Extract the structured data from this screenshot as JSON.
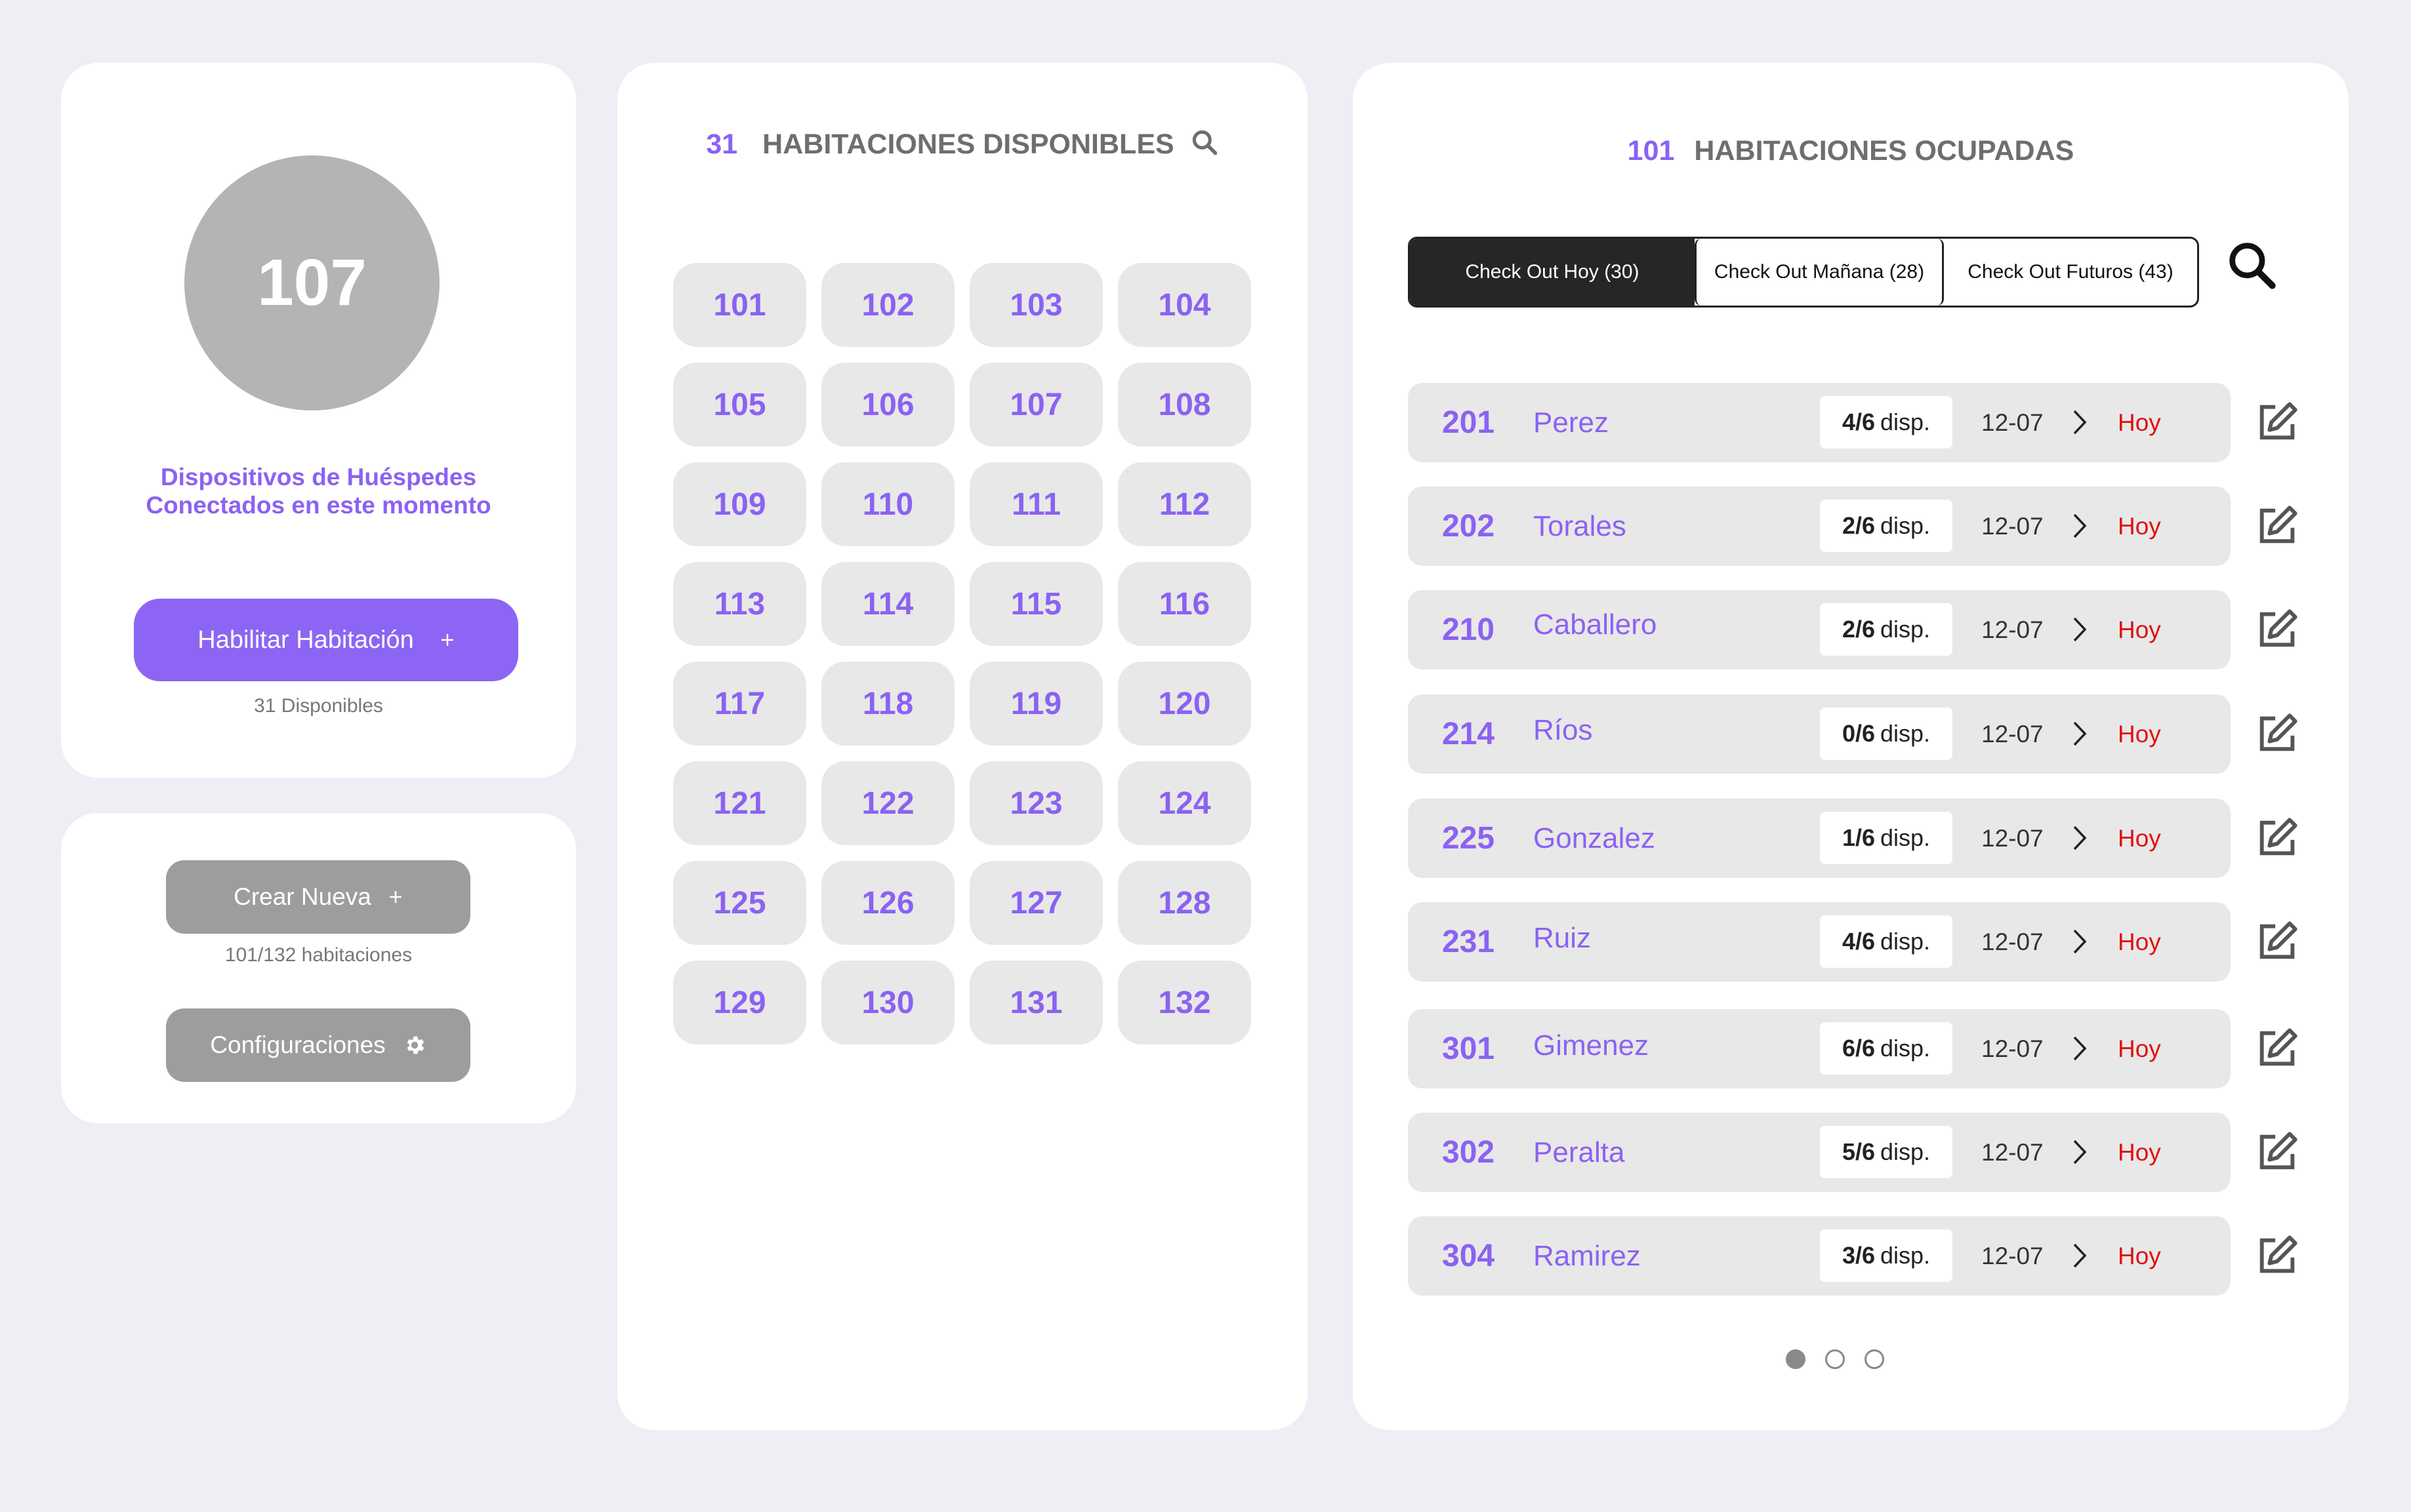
{
  "colors": {
    "accent": "#8b62f2",
    "danger": "#e01010",
    "background": "#eeeff4"
  },
  "devices": {
    "count": "107",
    "label_line1": "Dispositivos de Huéspedes",
    "label_line2": "Conectados en este momento",
    "enable_button": "Habilitar Habitación",
    "enable_button_icon": "plus-icon",
    "available_note": "31 Disponibles"
  },
  "actions": {
    "create_button": "Crear Nueva",
    "create_note": "101/132 habitaciones",
    "settings_button": "Configuraciones",
    "settings_icon": "gear-icon"
  },
  "available": {
    "count": "31",
    "title": "HABITACIONES DISPONIBLES",
    "rooms": [
      "101",
      "102",
      "103",
      "104",
      "105",
      "106",
      "107",
      "108",
      "109",
      "110",
      "111",
      "112",
      "113",
      "114",
      "115",
      "116",
      "117",
      "118",
      "119",
      "120",
      "121",
      "122",
      "123",
      "124",
      "125",
      "126",
      "127",
      "128",
      "129",
      "130",
      "131",
      "132"
    ]
  },
  "occupied": {
    "count": "101",
    "title": "HABITACIONES OCUPADAS",
    "tabs": [
      {
        "label": "Check Out Hoy (30)",
        "active": true
      },
      {
        "label": "Check Out Mañana (28)",
        "active": false
      },
      {
        "label": "Check Out Futuros (43)",
        "active": false
      }
    ],
    "rows": [
      {
        "room": "201",
        "name": "Perez",
        "devices": "4/6",
        "unit": "disp.",
        "date": "12-07",
        "status": "Hoy"
      },
      {
        "room": "202",
        "name": "Torales",
        "devices": "2/6",
        "unit": "disp.",
        "date": "12-07",
        "status": "Hoy"
      },
      {
        "room": "210",
        "name": "Caballero",
        "devices": "2/6",
        "unit": "disp.",
        "date": "12-07",
        "status": "Hoy"
      },
      {
        "room": "214",
        "name": "Ríos",
        "devices": "0/6",
        "unit": "disp.",
        "date": "12-07",
        "status": "Hoy"
      },
      {
        "room": "225",
        "name": "Gonzalez",
        "devices": "1/6",
        "unit": "disp.",
        "date": "12-07",
        "status": "Hoy"
      },
      {
        "room": "231",
        "name": "Ruiz",
        "devices": "4/6",
        "unit": "disp.",
        "date": "12-07",
        "status": "Hoy"
      },
      {
        "room": "301",
        "name": "Gimenez",
        "devices": "6/6",
        "unit": "disp.",
        "date": "12-07",
        "status": "Hoy"
      },
      {
        "room": "302",
        "name": "Peralta",
        "devices": "5/6",
        "unit": "disp.",
        "date": "12-07",
        "status": "Hoy"
      },
      {
        "room": "304",
        "name": "Ramirez",
        "devices": "3/6",
        "unit": "disp.",
        "date": "12-07",
        "status": "Hoy"
      }
    ],
    "pagination": {
      "pages": 3,
      "current": 1
    }
  }
}
